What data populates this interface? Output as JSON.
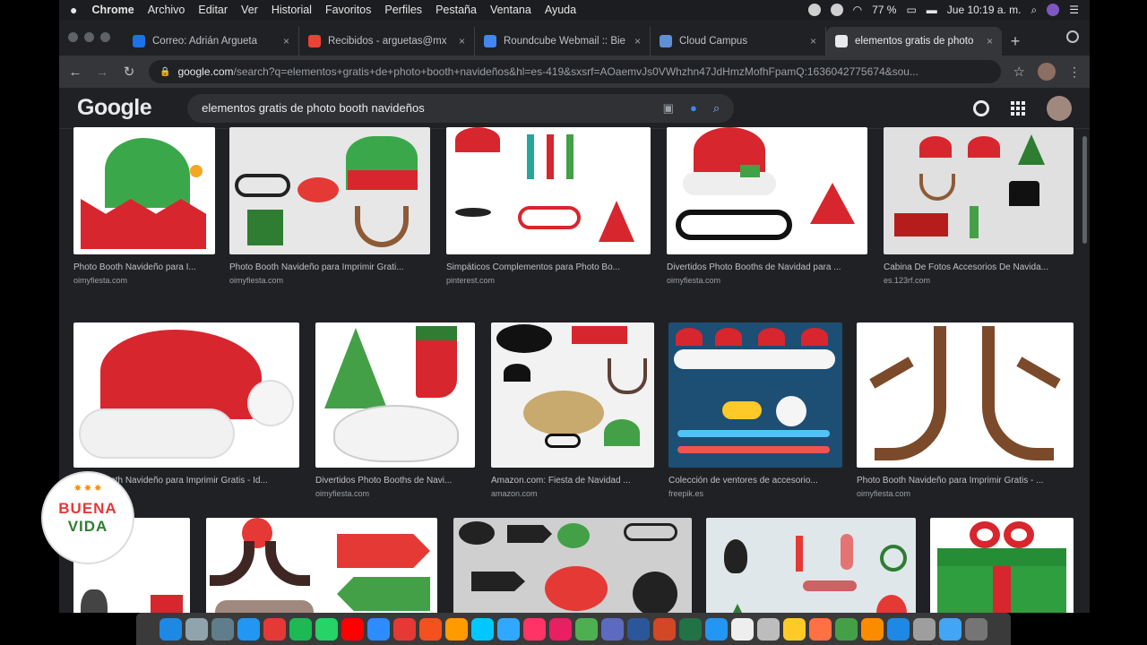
{
  "menubar": {
    "items": [
      "Chrome",
      "Archivo",
      "Editar",
      "Ver",
      "Historial",
      "Favoritos",
      "Perfiles",
      "Pestaña",
      "Ventana",
      "Ayuda"
    ],
    "battery": "77 %",
    "clock": "Jue 10:19 a. m."
  },
  "tabs": [
    {
      "title": "Correo: Adrián Argueta",
      "color": "#1a73e8"
    },
    {
      "title": "Recibidos - arguetas@mx",
      "color": "#ea4335"
    },
    {
      "title": "Roundcube Webmail :: Bie",
      "color": "#4285f4"
    },
    {
      "title": "Cloud Campus",
      "color": "#5f8fd6"
    },
    {
      "title": "elementos gratis de photo",
      "color": "#e8eaed",
      "active": true
    }
  ],
  "address": {
    "host": "google.com",
    "path": "/search?q=elementos+gratis+de+photo+booth+navideños&hl=es-419&sxsrf=AOaemvJs0VWhzhn47JdHmzMofhFpamQ:1636042775674&sou..."
  },
  "google": {
    "logo": "Google",
    "query": "elementos gratis de photo booth navideños"
  },
  "results_row1": [
    {
      "title": "Photo Booth Navideño para I...",
      "source": "oimyfiesta.com"
    },
    {
      "title": "Photo Booth Navideño para Imprimir Grati...",
      "source": "oimyfiesta.com"
    },
    {
      "title": "Simpáticos Complementos para Photo Bo...",
      "source": "pinterest.com"
    },
    {
      "title": "Divertidos Photo Booths de Navidad para ...",
      "source": "oimyfiesta.com"
    },
    {
      "title": "Cabina De Fotos Accesorios De Navida...",
      "source": "es.123rf.com"
    }
  ],
  "results_row2": [
    {
      "title": "Photo Booth Navideño para Imprimir Gratis - Id...",
      "source": "oimyfiesta.com"
    },
    {
      "title": "Divertidos Photo Booths de Navi...",
      "source": "oimyfiesta.com"
    },
    {
      "title": "Amazon.com: Fiesta de Navidad ...",
      "source": "amazon.com"
    },
    {
      "title": "Colección de ventores de accesorio...",
      "source": "freepik.es"
    },
    {
      "title": "Photo Booth Navideño para Imprimir Gratis - ...",
      "source": "oimyfiesta.com"
    }
  ],
  "overlay": {
    "line1": "BUENA",
    "line2": "VIDA"
  },
  "dock_colors": [
    "#1e88e5",
    "#90a4ae",
    "#607d8b",
    "#2196f3",
    "#e53935",
    "#1db954",
    "#25d366",
    "#ff0000",
    "#2d8cff",
    "#e53935",
    "#f4511e",
    "#ff9a00",
    "#00c8ff",
    "#31a8ff",
    "#ff3366",
    "#e91e63",
    "#4caf50",
    "#5c6bc0",
    "#2b579a",
    "#d24726",
    "#217346",
    "#2196f3",
    "#eeeeee",
    "#bdbdbd",
    "#ffca28",
    "#ff7043",
    "#43a047",
    "#fb8c00",
    "#1e88e5",
    "#9e9e9e",
    "#42a5f5",
    "#757575"
  ]
}
